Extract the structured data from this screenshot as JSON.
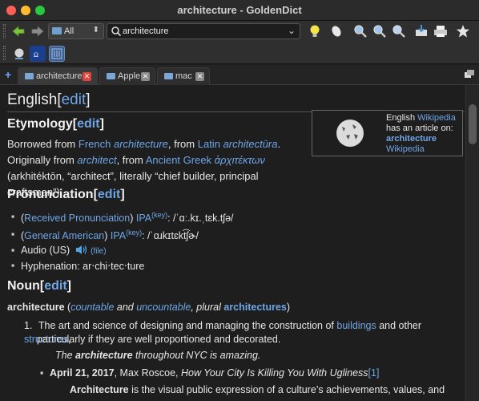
{
  "window": {
    "title": "architecture - GoldenDict"
  },
  "toolbar": {
    "group_combo": "All",
    "search_value": "architecture"
  },
  "tabs": [
    {
      "label": "architecture",
      "active": true
    },
    {
      "label": "Apple",
      "active": false
    },
    {
      "label": "mac",
      "active": false
    }
  ],
  "article": {
    "lang_heading": "English",
    "edit": "edit",
    "etymology": {
      "heading": "Etymology",
      "text_1": "Borrowed from ",
      "link_french": "French",
      "text_2": " ",
      "link_architecture": "architecture",
      "text_3": ", from ",
      "link_latin": "Latin",
      "text_4": " ",
      "link_architectura": "architectūra",
      "text_5": ". Originally from ",
      "link_architect": "architect",
      "text_6": ", from ",
      "link_ancient_greek": "Ancient Greek",
      "text_7": " ",
      "link_greek_word": "ἀρχιτέκτων",
      "text_8": " (arkhitéktōn, “architect”, literally “chief builder, principal craftsman”)."
    },
    "wikipedia": {
      "line1": "English ",
      "line1_link": "Wikipedia",
      "line2": "has an article on:",
      "article": "architecture",
      "source": "Wikipedia"
    },
    "pronunciation": {
      "heading": "Pronunciation",
      "items": [
        {
          "open": "(",
          "accent": "Received Pronunciation",
          "close": ") ",
          "ipa": "IPA",
          "key": "(key)",
          "value": ": /ˈɑː.kɪ.ˌtɛk.tʃə/"
        },
        {
          "open": "(",
          "accent": "General American",
          "close": ") ",
          "ipa": "IPA",
          "key": "(key)",
          "value": ": /ˈɑɹkɪtɛkt͡ʃɚ/"
        }
      ],
      "audio_label": "Audio (US)",
      "audio_file": "(file)",
      "hyphenation": "Hyphenation: ar‧chi‧tec‧ture"
    },
    "noun": {
      "heading": "Noun",
      "headword": "architecture",
      "open": " (",
      "countable": "countable",
      "and": " and ",
      "uncountable": "uncountable",
      "plural_text": ", plural ",
      "plural": "architectures",
      "close": ")",
      "sense1_num": "1.",
      "sense1_a": "The art and science of designing and managing the construction of ",
      "sense1_link1": "buildings",
      "sense1_b": " and other ",
      "sense1_link2": "structures",
      "sense1_c": ",",
      "sense1_line2": "particularly if they are well proportioned and decorated.",
      "example_pre": "The ",
      "example_bold": "architecture",
      "example_post": " throughout NYC is amazing.",
      "quote_date": "April 21, 2017",
      "quote_author": ", Max Roscoe, ",
      "quote_title": "How Your City Is Killing You With Ugliness",
      "quote_ref": "[1]",
      "quote_bold": "Architecture",
      "quote_text": " is the visual public expression of a culture’s achievements, values, and"
    }
  }
}
